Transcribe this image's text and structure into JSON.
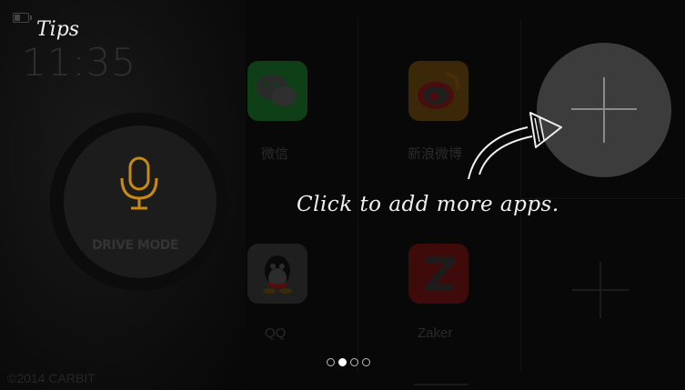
{
  "status": {
    "time": "11:35",
    "battery_icon": "battery-icon"
  },
  "drive_mode": {
    "label": "DRIVE MODE",
    "icon": "microphone-icon",
    "accent": "#c78a12"
  },
  "apps": [
    {
      "name": "微信",
      "icon": "wechat-icon",
      "color": "#2aa43a"
    },
    {
      "name": "新浪微博",
      "icon": "weibo-icon",
      "color": "#d89a2a"
    },
    {
      "name": "QQ",
      "icon": "qq-icon",
      "color": "#5a5a5a"
    },
    {
      "name": "Zaker",
      "icon": "zaker-icon",
      "color": "#c21f1f"
    }
  ],
  "tips": {
    "title": "Tips",
    "message": "Click to add more apps."
  },
  "pager": {
    "pages": 4,
    "active": 1
  },
  "footer": {
    "copyright": "©2014 CARBIT"
  }
}
